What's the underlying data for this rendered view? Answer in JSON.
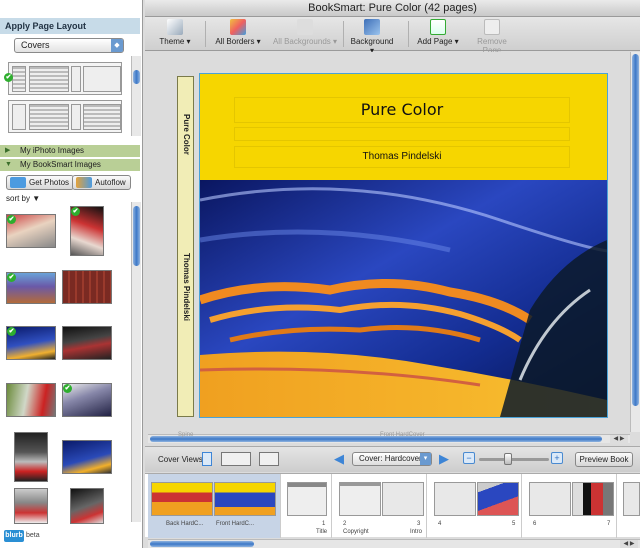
{
  "window": {
    "title": "BookSmart: Pure Color (42 pages)"
  },
  "toolbar": {
    "theme": "Theme ▾",
    "all_borders": "All Borders ▾",
    "all_backgrounds": "All Backgrounds ▾",
    "background": "Background ▾",
    "add_page": "Add Page ▾",
    "remove_page": "Remove Page"
  },
  "left": {
    "apply_layout": "Apply Page Layout",
    "layout_select": "Covers",
    "sources": [
      {
        "label": "My iPhoto Images",
        "arrow": "▶"
      },
      {
        "label": "My BookSmart Images",
        "arrow": "▼"
      }
    ],
    "get_photos": "Get Photos",
    "autoflow": "Autoflow",
    "sort_by": "sort by ▼",
    "check": "✔"
  },
  "spine": {
    "title": "Pure Color",
    "author": "Thomas Pindelski"
  },
  "cover": {
    "title": "Pure Color",
    "author": "Thomas Pindelski"
  },
  "view_labels": {
    "spine": "Spine",
    "front": "Front HardCover"
  },
  "bottom": {
    "cover_views": "Cover Views",
    "cover_select": "Cover: Hardcover",
    "arrow_down": "▾",
    "prev_arrow": "◀",
    "next_arrow": "▶",
    "zoom_out": "−",
    "zoom_in": "+",
    "zoom_level": 0.4,
    "preview_book": "Preview Book"
  },
  "scroll_arrows": "◀ ▶",
  "pages": {
    "back": "Back HardC...",
    "front": "Front HardC...",
    "p1": "1",
    "p1_name": "Title",
    "p2": "2",
    "p2_name": "Copyright",
    "p3": "3",
    "p3_name": "Intro",
    "p4": "4",
    "p5": "5",
    "p6": "6",
    "p7": "7"
  },
  "branding": {
    "logo": "blurb",
    "beta": "beta"
  }
}
